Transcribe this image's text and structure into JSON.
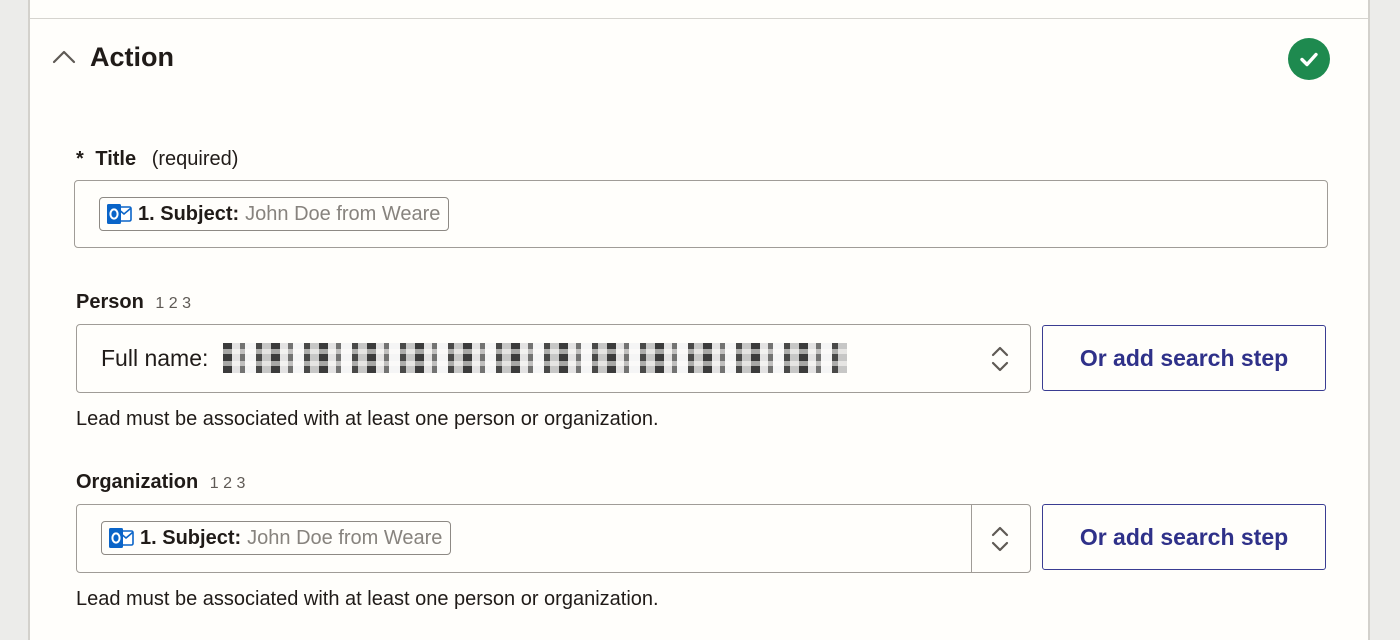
{
  "section": {
    "title": "Action",
    "status_icon": "check-circle-icon",
    "status_color": "#1e8a4f",
    "collapse_icon": "chevron-up-icon"
  },
  "title_field": {
    "label": "Title",
    "required_marker": "*",
    "required_text": "(required)",
    "token": {
      "icon": "outlook-icon",
      "step": "1. Subject:",
      "value": "John Doe from Weare"
    }
  },
  "person_field": {
    "label": "Person",
    "hint": "1 2 3",
    "value_prefix": "Full name:",
    "value_redacted": true,
    "search_button": "Or add search step",
    "help": "Lead must be associated with at least one person or organization."
  },
  "organization_field": {
    "label": "Organization",
    "hint": "1 2 3",
    "token": {
      "icon": "outlook-icon",
      "step": "1. Subject:",
      "value": "John Doe from Weare"
    },
    "search_button": "Or add search step",
    "help": "Lead must be associated with at least one person or organization."
  },
  "colors": {
    "accent": "#2f3189",
    "outlook_blue": "#0a64c8"
  }
}
